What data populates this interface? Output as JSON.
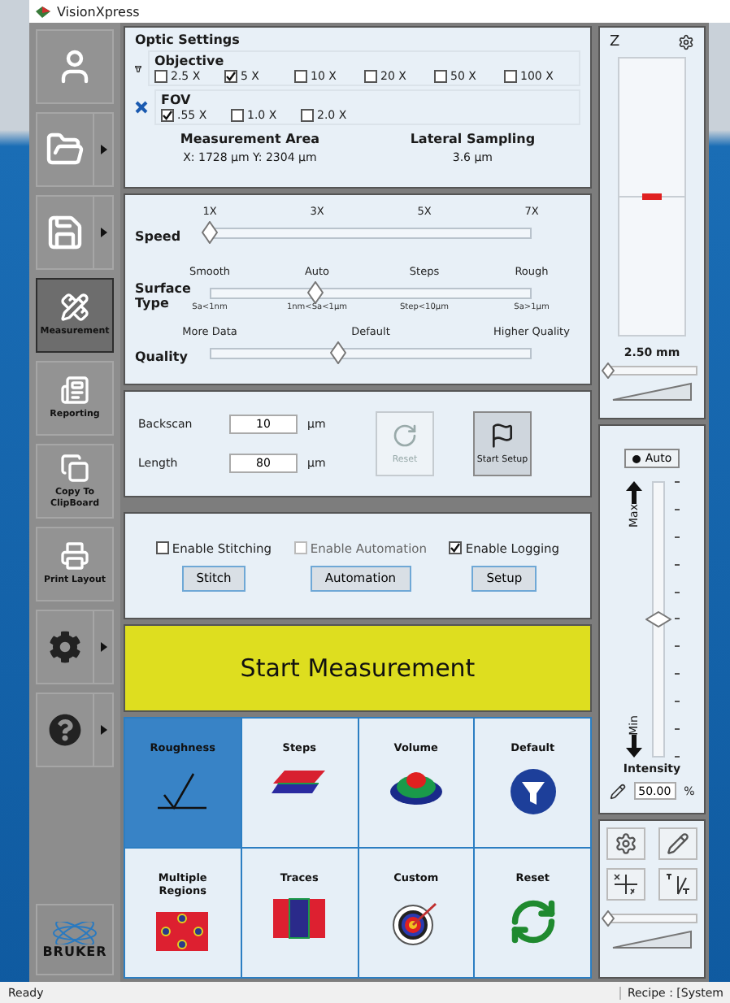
{
  "window": {
    "title": "VisionXpress"
  },
  "sidebar": {
    "items": [
      {
        "kind": "button",
        "selected": false
      },
      {
        "kind": "menu",
        "selected": false
      },
      {
        "kind": "menu",
        "selected": false
      },
      {
        "kind": "button",
        "label": "Measurement",
        "selected": true
      },
      {
        "kind": "button",
        "label": "Reporting",
        "selected": false
      },
      {
        "kind": "button",
        "label": "Copy To ClipBoard",
        "selected": false
      },
      {
        "kind": "button",
        "label": "Print Layout",
        "selected": false
      },
      {
        "kind": "menu",
        "selected": false
      },
      {
        "kind": "menu",
        "selected": false
      }
    ],
    "logo": "BRUKER"
  },
  "optic_settings": {
    "title": "Optic Settings",
    "objective": {
      "label": "Objective",
      "options": [
        {
          "label": "2.5 X",
          "checked": false
        },
        {
          "label": "5 X",
          "checked": true
        },
        {
          "label": "10 X",
          "checked": false
        },
        {
          "label": "20 X",
          "checked": false
        },
        {
          "label": "50 X",
          "checked": false
        },
        {
          "label": "100 X",
          "checked": false
        }
      ]
    },
    "fov": {
      "label": "FOV",
      "options": [
        {
          "label": ".55 X",
          "checked": true
        },
        {
          "label": "1.0 X",
          "checked": false
        },
        {
          "label": "2.0 X",
          "checked": false
        }
      ]
    },
    "measurement_area": {
      "label": "Measurement Area",
      "value": "X: 1728 µm Y: 2304 µm"
    },
    "lateral_sampling": {
      "label": "Lateral Sampling",
      "value": "3.6 µm"
    }
  },
  "sliders": [
    {
      "label": "Speed",
      "ticks": [
        "1X",
        "3X",
        "5X",
        "7X"
      ],
      "level": 0
    },
    {
      "label": "Surface Type",
      "ticks": [
        "Smooth",
        "Auto",
        "Steps",
        "Rough"
      ],
      "sublabels": [
        "Sa<1nm",
        "1nm<Sa<1µm",
        "Step<10µm",
        "Sa>1µm"
      ],
      "level": 0.33
    },
    {
      "label": "Quality",
      "ticks": [
        "More Data",
        "Default",
        "Higher Quality"
      ],
      "level": 0.4
    }
  ],
  "scan_setup": {
    "fields": [
      {
        "label": "Backscan",
        "value": "10",
        "unit": "µm"
      },
      {
        "label": "Length",
        "value": "80",
        "unit": "µm"
      }
    ],
    "reset": {
      "label": "Reset",
      "disabled": true
    },
    "start_setup": {
      "label": "Start Setup",
      "disabled": false
    }
  },
  "options": [
    {
      "label": "Enable Stitching",
      "checked": false,
      "disabled": false,
      "button": "Stitch"
    },
    {
      "label": "Enable Automation",
      "checked": false,
      "disabled": true,
      "button": "Automation"
    },
    {
      "label": "Enable Logging",
      "checked": true,
      "disabled": false,
      "button": "Setup"
    }
  ],
  "start_button": "Start Measurement",
  "measurement_types": [
    {
      "label": "Roughness",
      "selected": true
    },
    {
      "label": "Steps",
      "selected": false
    },
    {
      "label": "Volume",
      "selected": false
    },
    {
      "label": "Default",
      "selected": false
    },
    {
      "label": "Multiple Regions",
      "selected": false
    },
    {
      "label": "Traces",
      "selected": false
    },
    {
      "label": "Custom",
      "selected": false
    },
    {
      "label": "Reset",
      "selected": false
    }
  ],
  "z_panel": {
    "label": "Z",
    "value": "2.50 mm",
    "level": 0
  },
  "intensity": {
    "auto": {
      "label": "Auto",
      "selected": true
    },
    "max": "Max",
    "min": "Min",
    "title": "Intensity",
    "level": 0.5,
    "value": "50.00",
    "unit": "%"
  },
  "tools": {
    "level": 0
  },
  "status_bar": {
    "left": "Ready",
    "right": "Recipe : [System"
  }
}
